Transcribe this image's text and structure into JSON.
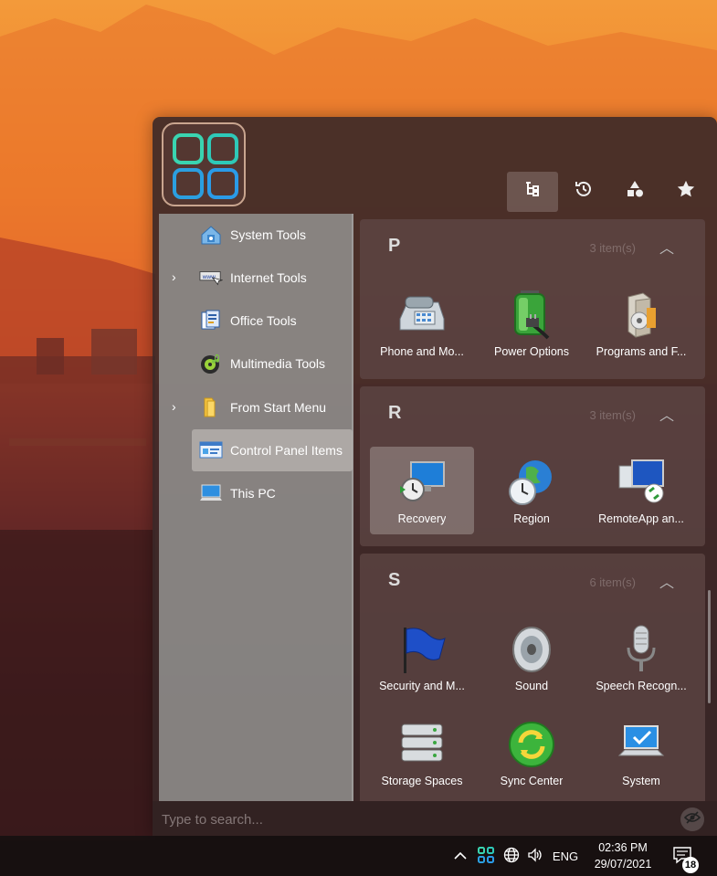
{
  "launcher": {
    "tabs": [
      {
        "icon": "tree-view-icon",
        "active": true
      },
      {
        "icon": "history-icon",
        "active": false
      },
      {
        "icon": "shapes-icon",
        "active": false
      },
      {
        "icon": "star-icon",
        "active": false
      }
    ],
    "sidebar": {
      "items": [
        {
          "label": "System Tools",
          "icon": "home-tools-icon",
          "expandable": false
        },
        {
          "label": "Internet Tools",
          "icon": "www-icon",
          "expandable": true
        },
        {
          "label": "Office Tools",
          "icon": "documents-icon",
          "expandable": false
        },
        {
          "label": "Multimedia Tools",
          "icon": "music-disc-icon",
          "expandable": false
        },
        {
          "label": "From Start Menu",
          "icon": "folder-icon",
          "expandable": true
        },
        {
          "label": "Control Panel Items",
          "icon": "control-panel-icon",
          "expandable": false,
          "active": true
        },
        {
          "label": "This PC",
          "icon": "computer-icon",
          "expandable": false
        }
      ]
    },
    "groups": [
      {
        "letter": "P",
        "count": "3 item(s)",
        "items": [
          {
            "label": "Phone and Mo...",
            "icon": "phone-modem-icon"
          },
          {
            "label": "Power Options",
            "icon": "battery-plug-icon"
          },
          {
            "label": "Programs and F...",
            "icon": "programs-box-icon"
          }
        ]
      },
      {
        "letter": "R",
        "count": "3 item(s)",
        "items": [
          {
            "label": "Recovery",
            "icon": "recovery-monitor-icon",
            "active": true
          },
          {
            "label": "Region",
            "icon": "globe-clock-icon"
          },
          {
            "label": "RemoteApp an...",
            "icon": "remote-desktop-icon"
          }
        ]
      },
      {
        "letter": "S",
        "count": "6 item(s)",
        "items": [
          {
            "label": "Security and M...",
            "icon": "blue-flag-icon"
          },
          {
            "label": "Sound",
            "icon": "speaker-icon"
          },
          {
            "label": "Speech Recogn...",
            "icon": "microphone-icon"
          },
          {
            "label": "Storage Spaces",
            "icon": "hard-drives-icon"
          },
          {
            "label": "Sync Center",
            "icon": "sync-icon"
          },
          {
            "label": "System",
            "icon": "laptop-check-icon"
          }
        ]
      }
    ],
    "search": {
      "placeholder": "Type to search..."
    }
  },
  "taskbar": {
    "language": "ENG",
    "time": "02:36 PM",
    "date": "29/07/2021",
    "notifications": "18"
  }
}
